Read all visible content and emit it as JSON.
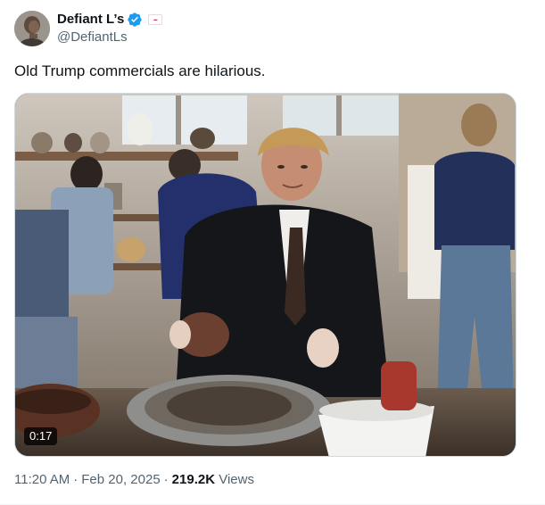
{
  "author": {
    "display_name": "Defiant L’s",
    "handle": "@DefiantLs",
    "verified_icon": "verified-badge-icon",
    "affiliate_icon": "affiliate-badge-icon",
    "badge_color": "#1d9bf0"
  },
  "tweet": {
    "text": "Old Trump commercials are hilarious."
  },
  "media": {
    "type": "video",
    "duration": "0:17"
  },
  "meta": {
    "time": "11:20 AM",
    "date": "Feb 20, 2025",
    "separator": "·",
    "views_count": "219.2K",
    "views_label": "Views"
  },
  "colors": {
    "text_primary": "#0f1419",
    "text_secondary": "#536471",
    "border": "#cfd9de"
  }
}
